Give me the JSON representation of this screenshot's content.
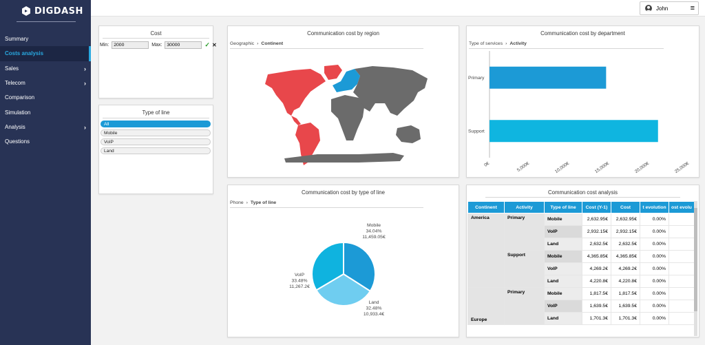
{
  "app": {
    "logo_text": "DIGDASH"
  },
  "sidebar": {
    "items": [
      {
        "label": "Summary",
        "has_chevron": false
      },
      {
        "label": "Costs analysis",
        "has_chevron": false,
        "active": true
      },
      {
        "label": "Sales",
        "has_chevron": true
      },
      {
        "label": "Telecom",
        "has_chevron": true
      },
      {
        "label": "Comparison",
        "has_chevron": false
      },
      {
        "label": "Simulation",
        "has_chevron": false
      },
      {
        "label": "Analysis",
        "has_chevron": true
      },
      {
        "label": "Questions",
        "has_chevron": false
      }
    ]
  },
  "topbar": {
    "user_name": "John"
  },
  "cost_filter": {
    "title": "Cost",
    "min_label": "Min:",
    "min_value": "2000",
    "max_label": "Max:",
    "max_value": "30000",
    "apply_icon": "✓",
    "clear_icon": "✕"
  },
  "type_of_line": {
    "title": "Type of line",
    "options": [
      "All",
      "Mobile",
      "VoIP",
      "Land"
    ],
    "selected": "All"
  },
  "region_map": {
    "title": "Communication cost by region",
    "crumb_parent": "Geographic",
    "crumb_child": "Continent",
    "colors": {
      "america": "#e8474b",
      "europe": "#1c9ad6",
      "other": "#6b6b6b"
    }
  },
  "department": {
    "title": "Communication cost by department",
    "crumb_parent": "Type of services",
    "crumb_child": "Activity",
    "chart_data": {
      "type": "bar",
      "orientation": "horizontal",
      "categories": [
        "Primary",
        "Support"
      ],
      "values": [
        14600,
        21100
      ],
      "xlim": [
        0,
        25000
      ],
      "xticks": [
        "0€",
        "5,000€",
        "10,000€",
        "15,000€",
        "20,000€",
        "25,000€"
      ],
      "colors": [
        "#1c9ad6",
        "#0fb5e0"
      ]
    }
  },
  "line_type_pie": {
    "title": "Communication cost by type of line",
    "crumb_parent": "Phone",
    "crumb_child": "Type of line",
    "chart_data": {
      "type": "pie",
      "slices": [
        {
          "name": "Mobile",
          "pct": "34.04%",
          "amount": "11,459.05€",
          "value": 34.04,
          "color": "#1c9ad6"
        },
        {
          "name": "Land",
          "pct": "32.48%",
          "amount": "10,933.4€",
          "value": 32.48,
          "color": "#6fcdf0"
        },
        {
          "name": "VoIP",
          "pct": "33.48%",
          "amount": "11,267.2€",
          "value": 33.48,
          "color": "#0fb3df"
        }
      ]
    }
  },
  "analysis_table": {
    "title": "Communication cost analysis",
    "columns": [
      "Continent",
      "Activity",
      "Type of line",
      "Cost (Y-1)",
      "Cost",
      "t evolution",
      "ost evolu"
    ],
    "groups": {
      "america": "America",
      "primary": "Primary",
      "support": "Support",
      "europe": "Europe",
      "europe_primary": "Primary"
    },
    "rows": [
      {
        "line": "Mobile",
        "y1": "2,632.95€",
        "cost": "2,632.95€",
        "evo": "0.00%"
      },
      {
        "line": "VoIP",
        "y1": "2,932.15€",
        "cost": "2,932.15€",
        "evo": "0.00%"
      },
      {
        "line": "Land",
        "y1": "2,632.5€",
        "cost": "2,632.5€",
        "evo": "0.00%"
      },
      {
        "line": "Mobile",
        "y1": "4,365.85€",
        "cost": "4,365.85€",
        "evo": "0.00%"
      },
      {
        "line": "VoIP",
        "y1": "4,269.2€",
        "cost": "4,269.2€",
        "evo": "0.00%"
      },
      {
        "line": "Land",
        "y1": "4,220.8€",
        "cost": "4,220.8€",
        "evo": "0.00%"
      },
      {
        "line": "Mobile",
        "y1": "1,817.5€",
        "cost": "1,817.5€",
        "evo": "0.00%"
      },
      {
        "line": "VoIP",
        "y1": "1,639.5€",
        "cost": "1,639.5€",
        "evo": "0.00%"
      },
      {
        "line": "Land",
        "y1": "1,701.3€",
        "cost": "1,701.3€",
        "evo": "0.00%"
      }
    ]
  }
}
